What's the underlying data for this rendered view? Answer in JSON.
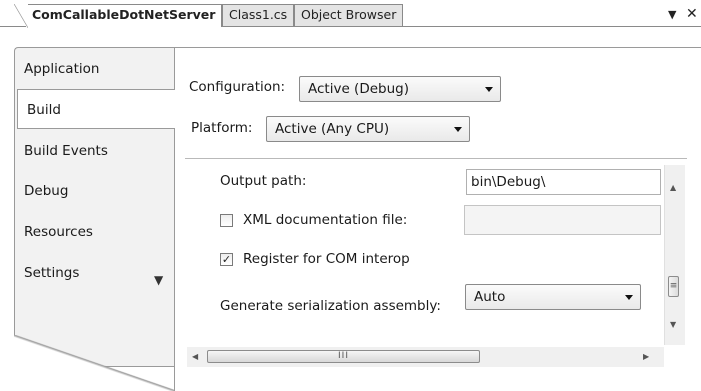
{
  "document_tabs": [
    {
      "label": "ComCallableDotNetServer",
      "active": true
    },
    {
      "label": "Class1.cs",
      "active": false
    },
    {
      "label": "Object Browser",
      "active": false
    }
  ],
  "window_controls": {
    "dropdown_icon": "chevron-down-icon",
    "close_icon": "close-icon"
  },
  "side_tabs": [
    {
      "label": "Application"
    },
    {
      "label": "Build",
      "active": true
    },
    {
      "label": "Build Events"
    },
    {
      "label": "Debug"
    },
    {
      "label": "Resources"
    },
    {
      "label": "Settings"
    }
  ],
  "build": {
    "configuration": {
      "label": "Configuration:",
      "value": "Active (Debug)"
    },
    "platform": {
      "label": "Platform:",
      "value": "Active (Any CPU)"
    },
    "output_path": {
      "label": "Output path:",
      "value": "bin\\Debug\\"
    },
    "xml_doc": {
      "label": "XML documentation file:",
      "checked": false,
      "value": ""
    },
    "com_interop": {
      "label": "Register for COM interop",
      "checked": true
    },
    "serialization": {
      "label": "Generate serialization assembly:",
      "value": "Auto"
    }
  }
}
